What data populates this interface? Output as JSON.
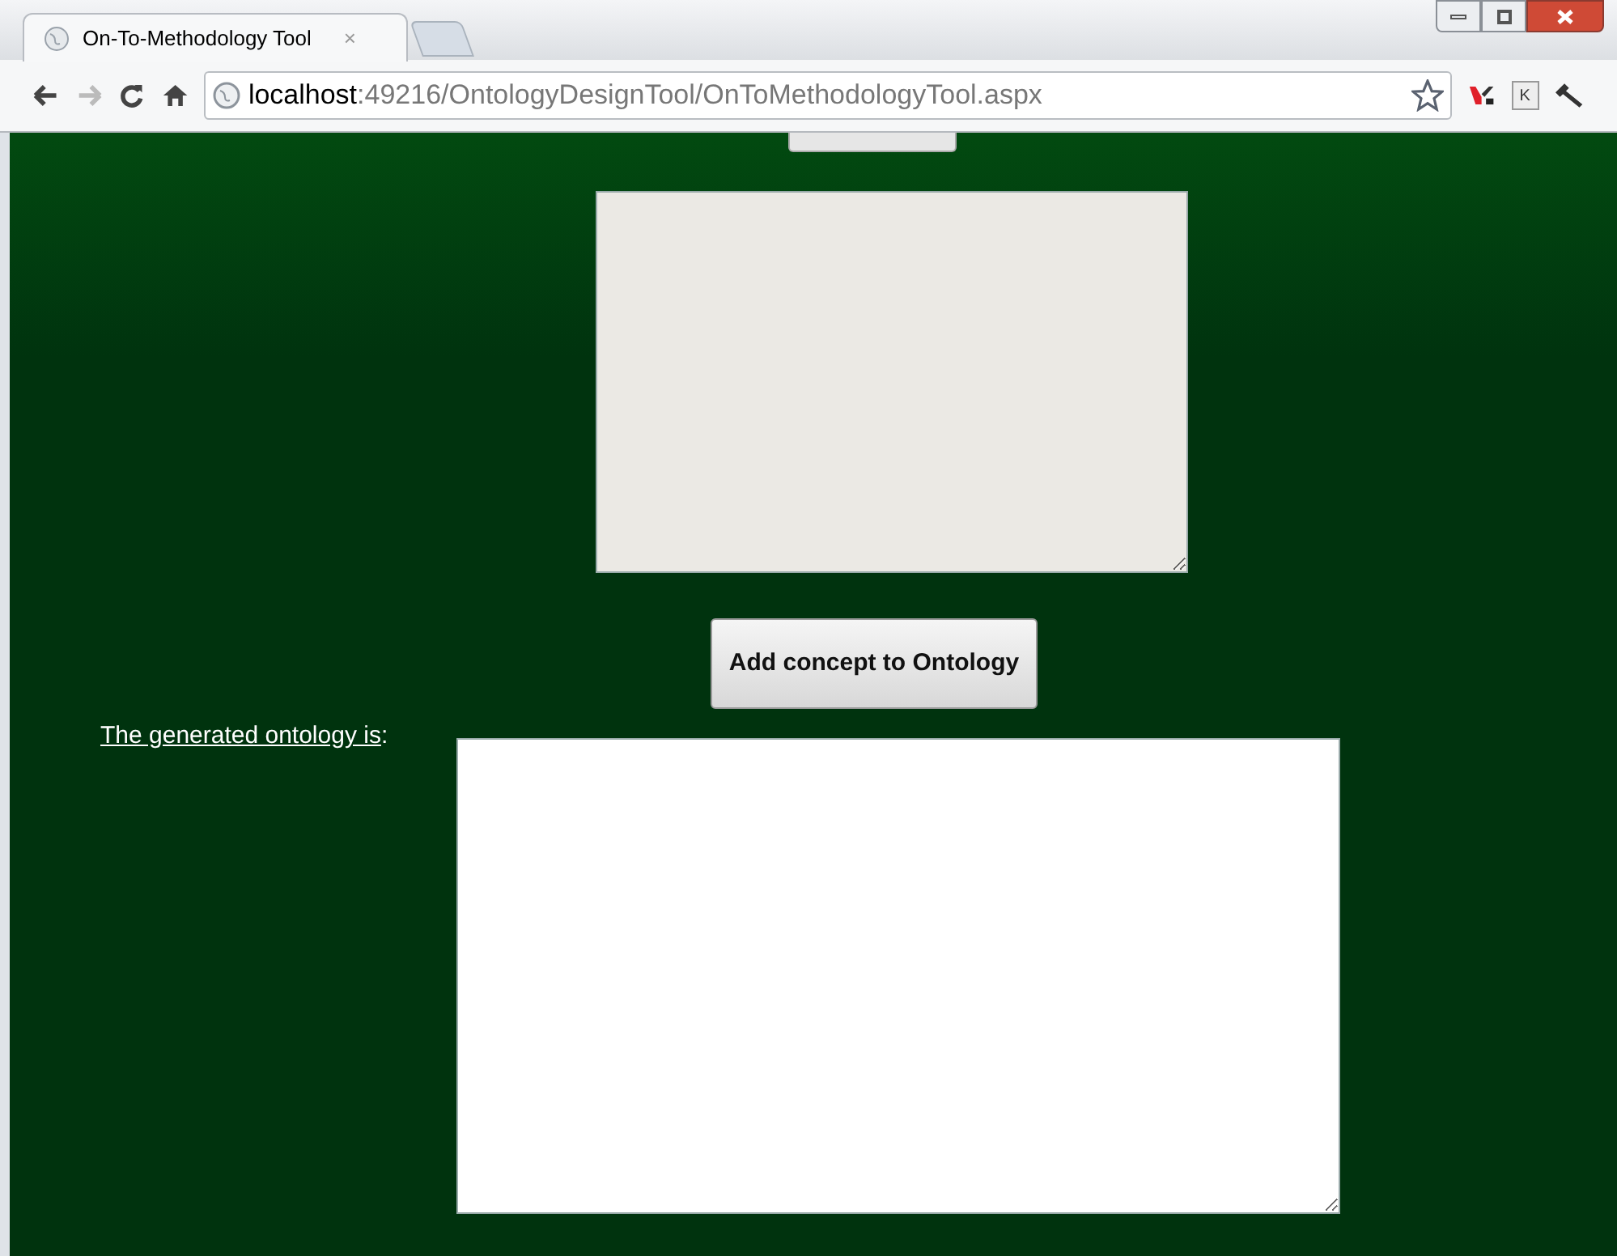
{
  "window": {
    "title": "On-To-Methodology Tool",
    "close_glyph": "×"
  },
  "toolbar": {
    "url_host": "localhost",
    "url_path": ":49216/OntologyDesignTool/OnToMethodologyTool.aspx",
    "extension_letter": "K"
  },
  "page": {
    "concept_field": {
      "disabled": true
    },
    "add_button": {
      "label": "Add concept to Ontology"
    },
    "output_label": {
      "text": "The generated ontology is",
      "suffix": ":"
    },
    "output_field": {
      "disabled": false
    }
  }
}
